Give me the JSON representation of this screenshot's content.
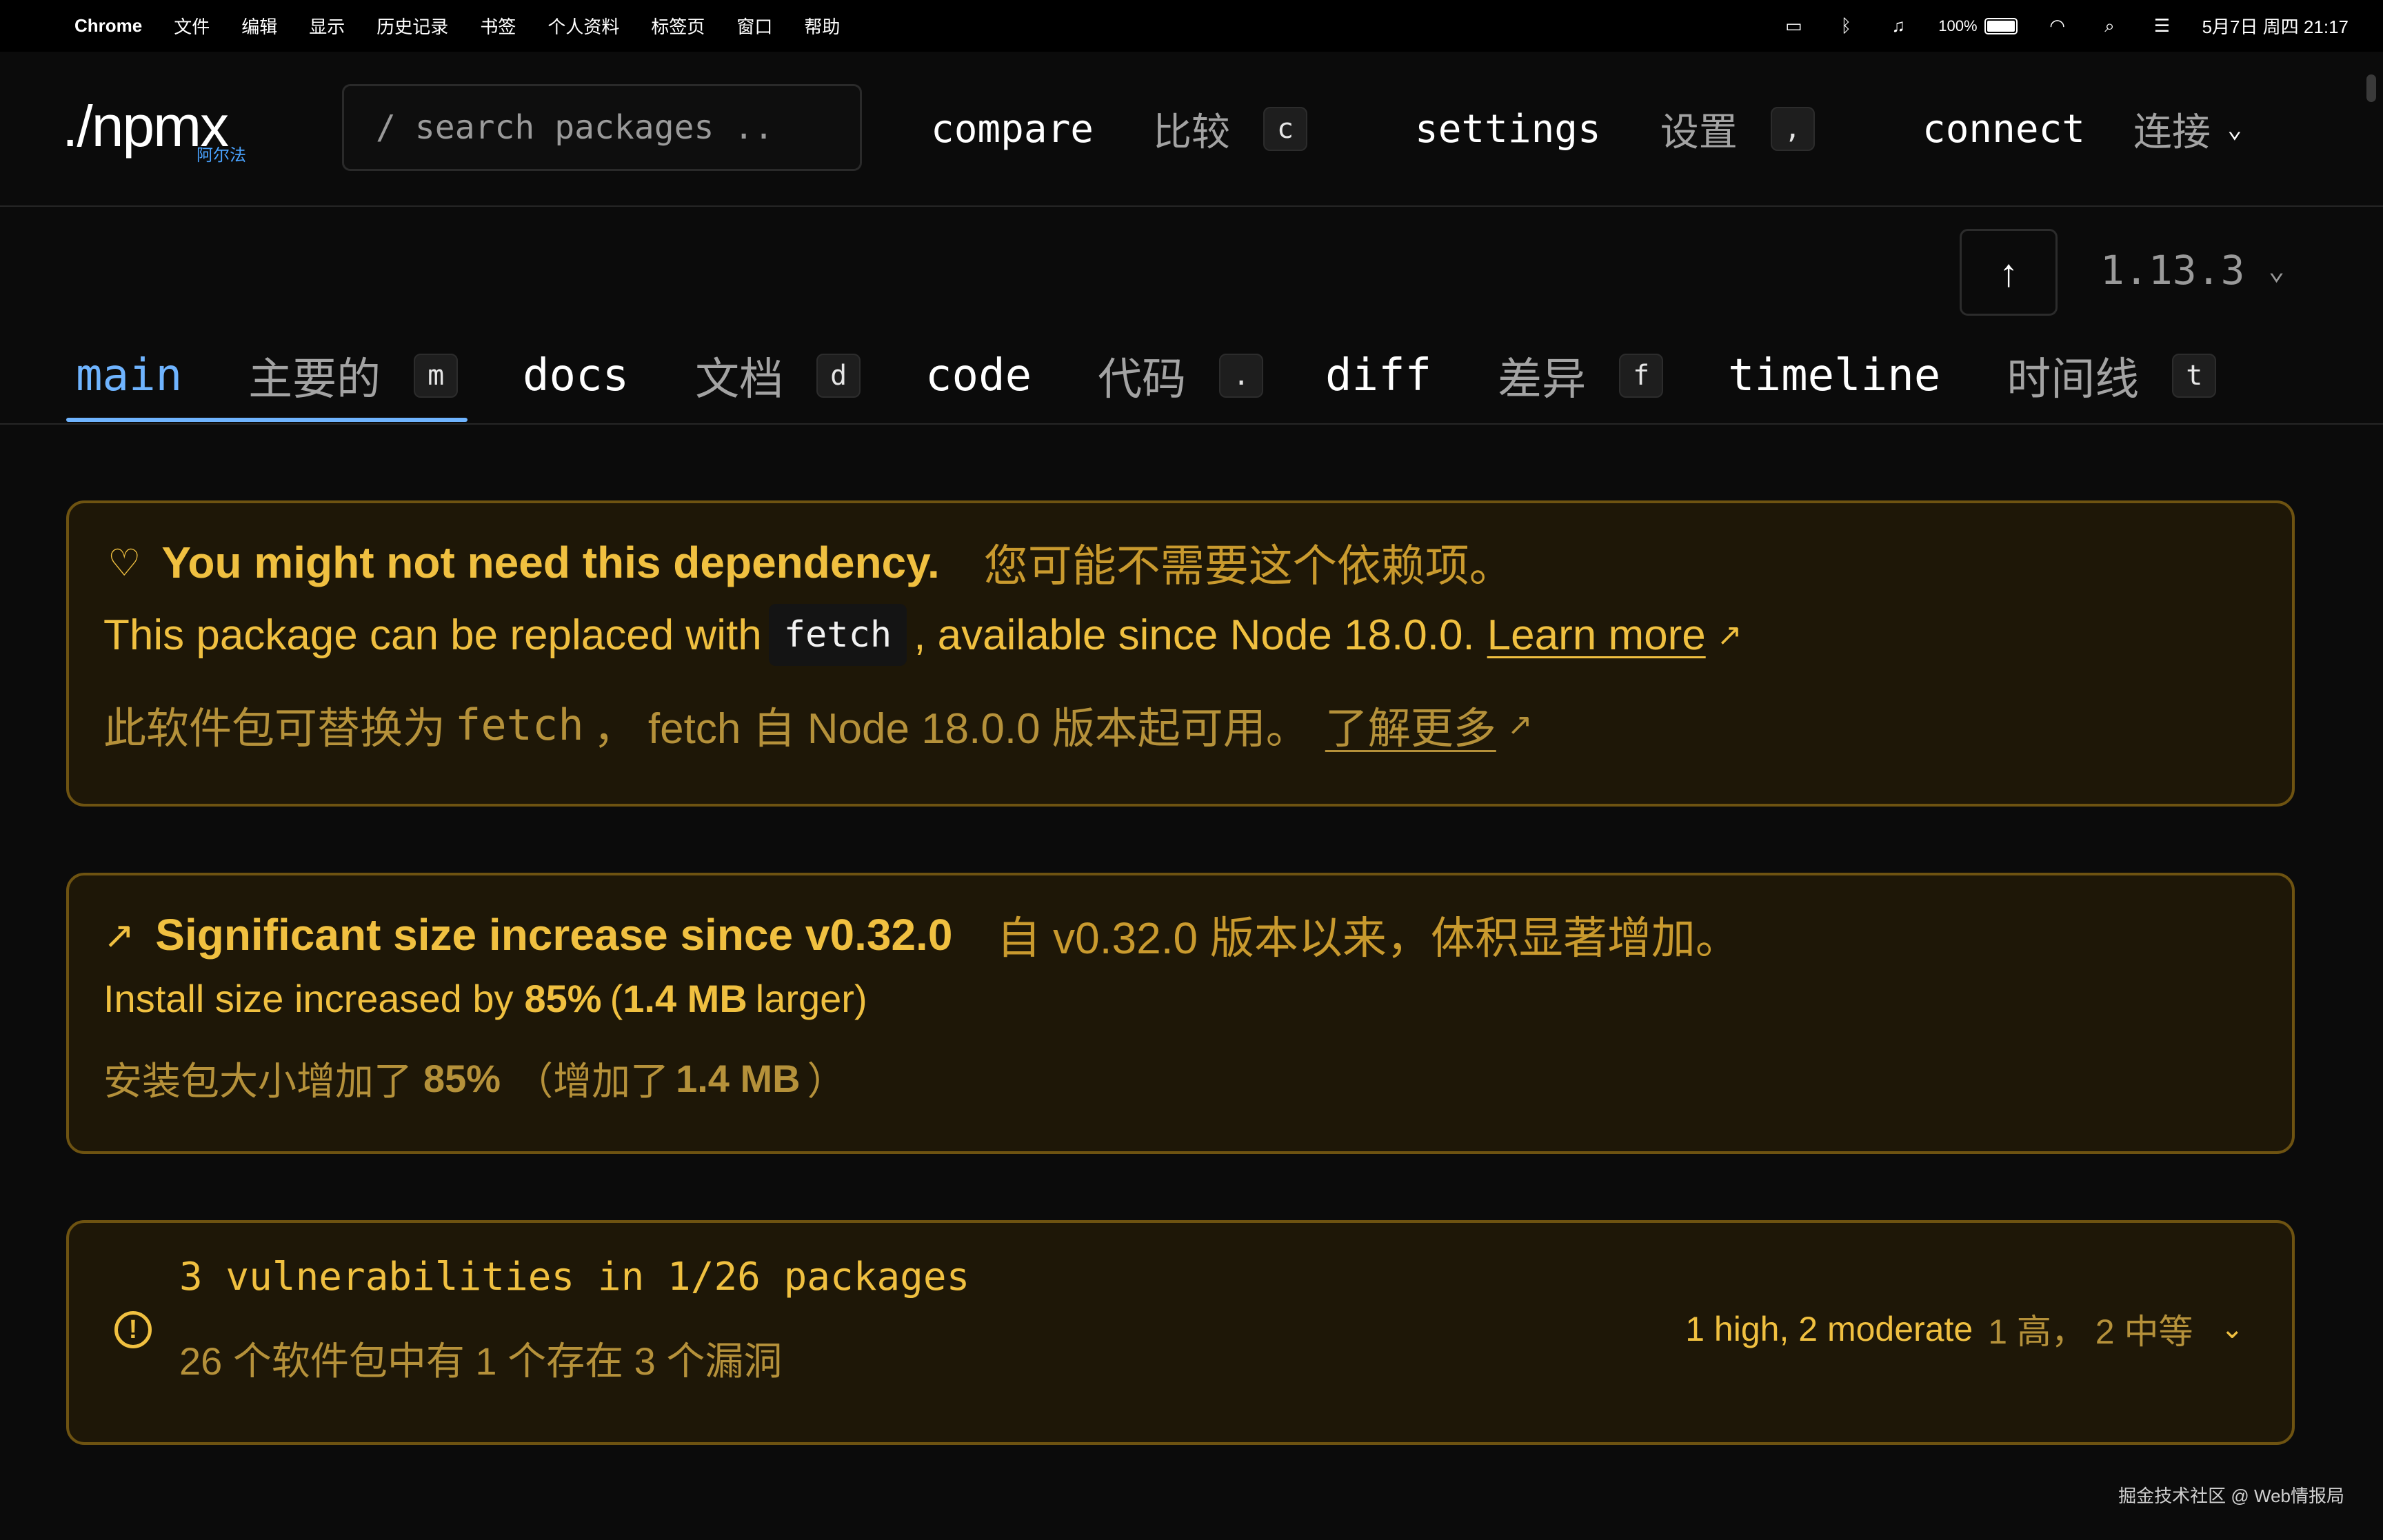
{
  "menubar": {
    "app": "Chrome",
    "items": [
      "文件",
      "编辑",
      "显示",
      "历史记录",
      "书签",
      "个人资料",
      "标签页",
      "窗口",
      "帮助"
    ],
    "battery": "100%",
    "datetime": "5月7日 周四 21:17"
  },
  "header": {
    "logo_prefix": "./",
    "logo_name": "npmx",
    "logo_sub": "阿尔法",
    "search_prefix": "/",
    "search_placeholder": "search packages ..",
    "nav": [
      {
        "label": "compare",
        "zh": "比较",
        "key": "c"
      },
      {
        "label": "settings",
        "zh": "设置",
        "key": ","
      },
      {
        "label": "connect",
        "zh": "连接"
      }
    ]
  },
  "version": {
    "value": "1.13.3"
  },
  "tabs": [
    {
      "label": "main",
      "zh": "主要的",
      "key": "m"
    },
    {
      "label": "docs",
      "zh": "文档",
      "key": "d"
    },
    {
      "label": "code",
      "zh": "代码",
      "key": "."
    },
    {
      "label": "diff",
      "zh": "差异",
      "key": "f"
    },
    {
      "label": "timeline",
      "zh": "时间线",
      "key": "t"
    }
  ],
  "cards": {
    "dependency": {
      "title": "You might not need this dependency.",
      "title_zh": "您可能不需要这个依赖项。",
      "line1_a": "This package can be replaced with",
      "line1_code": "fetch",
      "line1_b": ", available since Node 18.0.0.",
      "learn_more": "Learn more",
      "line2_a": "此软件包可替换为",
      "line2_code": "fetch",
      "line2_b": "， fetch 自 Node 18.0.0 版本起可用。",
      "learn_more_zh": "了解更多"
    },
    "size": {
      "title": "Significant size increase since v0.32.0",
      "title_zh": "自 v0.32.0 版本以来，体积显著增加。",
      "line1_a": "Install size increased by",
      "line1_pct": "85%",
      "line1_b": "(",
      "line1_mb": "1.4 MB",
      "line1_c": "larger)",
      "line2_a": "安装包大小增加了",
      "line2_pct": "85%",
      "line2_b": "（增加了",
      "line2_mb": "1.4 MB",
      "line2_c": "）"
    },
    "vuln": {
      "title": "3 vulnerabilities in 1/26 packages",
      "title_zh": "26 个软件包中有 1 个存在 3 个漏洞",
      "summary": "1 high, 2 moderate",
      "summary_zh": "1 高， 2 中等"
    }
  },
  "watermark": "掘金技术社区 @ Web情报局",
  "colors": {
    "accent": "#6fb4ff",
    "warn": "#f0c040",
    "card_border": "#6e5311",
    "card_bg": "#1e1707"
  }
}
